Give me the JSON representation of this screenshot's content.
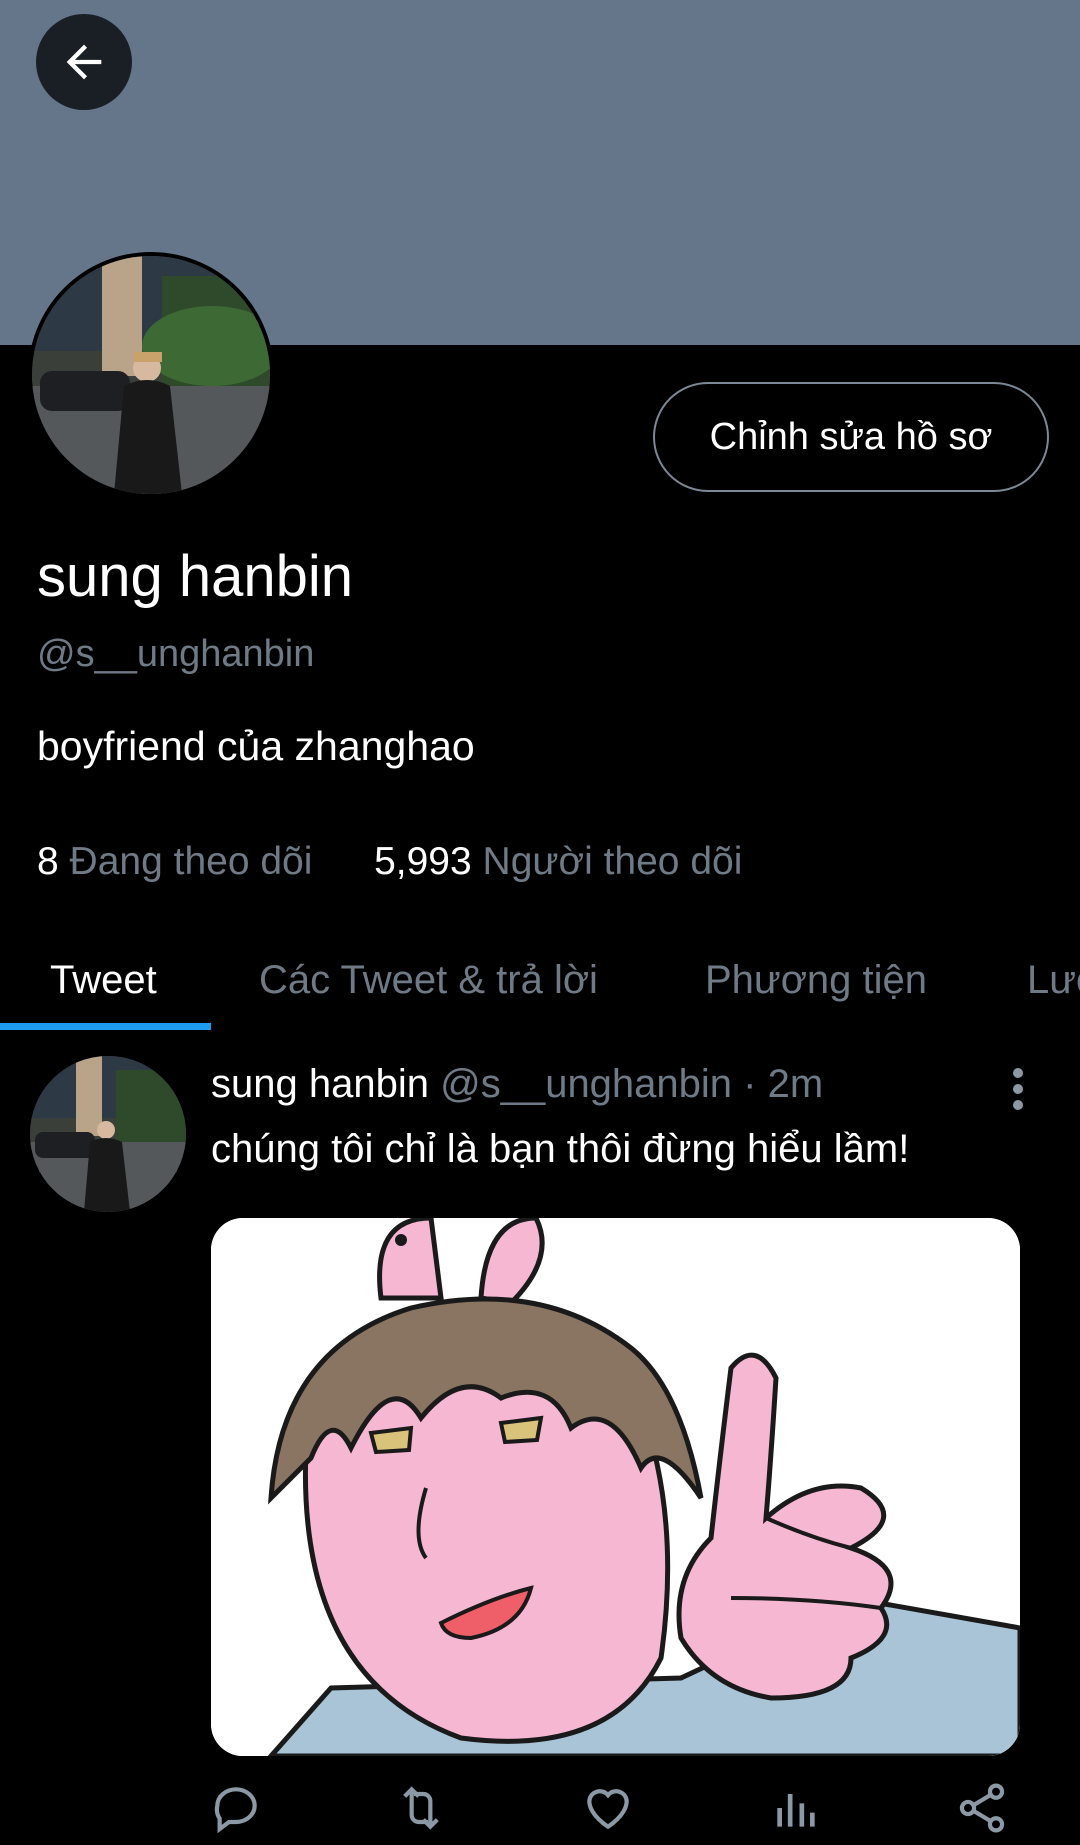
{
  "header": {
    "back_icon": "arrow-left-icon",
    "banner_color": "#66768a"
  },
  "profile": {
    "name": "sung hanbin",
    "handle": "@s__unghanbin",
    "bio": "boyfriend của zhanghao",
    "edit_button_label": "Chỉnh sửa hồ sơ",
    "following_count": "8",
    "following_label": "Đang theo dõi",
    "followers_count": "5,993",
    "followers_label": "Người theo dõi"
  },
  "tabs": [
    {
      "label": "Tweet",
      "active": true
    },
    {
      "label": "Các Tweet & trả lời",
      "active": false
    },
    {
      "label": "Phương tiện",
      "active": false
    },
    {
      "label": "Lượt thích",
      "active": false
    }
  ],
  "tweet": {
    "author_name": "sung hanbin",
    "author_handle": "@s__unghanbin",
    "separator": "·",
    "time": "2m",
    "text": "chúng tôi chỉ là bạn thôi đừng hiểu lầm!",
    "media": "cartoon-pointing-boy-image",
    "actions": [
      "reply-icon",
      "retweet-icon",
      "like-icon",
      "analytics-icon",
      "share-icon"
    ]
  },
  "colors": {
    "accent": "#1d9bf0",
    "muted_text": "#6e7a86",
    "background": "#000000"
  }
}
